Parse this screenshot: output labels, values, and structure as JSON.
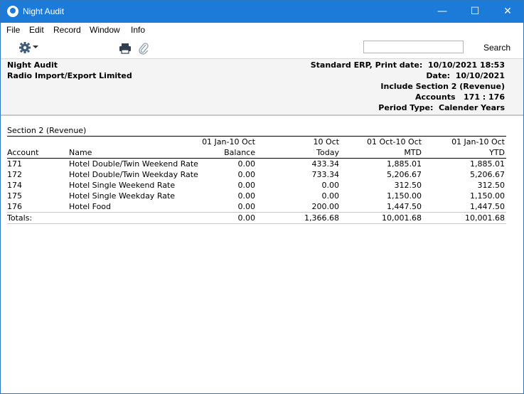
{
  "window": {
    "title": "Night Audit",
    "controls": {
      "minimize": "—",
      "maximize": "☐",
      "close": "✕"
    }
  },
  "menu": [
    "File",
    "Edit",
    "Record",
    "Window",
    "Info"
  ],
  "toolbar": {
    "icons": [
      "gear-icon",
      "chevron-down-icon",
      "printer-icon",
      "paperclip-icon"
    ],
    "search_value": "",
    "search_button": "Search"
  },
  "header": {
    "report_name": "Night Audit",
    "company": "Radio Import/Export Limited",
    "product_line": "Standard ERP, Print date:  10/10/2021 18:53",
    "date_line": "Date:  10/10/2021",
    "include_line": "Include Section 2 (Revenue)",
    "accounts_line": "Accounts   171 : 176",
    "period_line": "Period Type:  Calender Years"
  },
  "report": {
    "section_title": "Section 2 (Revenue)",
    "column_ranges": [
      "01 Jan-10 Oct",
      "10 Oct",
      "01 Oct-10 Oct",
      "01 Jan-10 Oct"
    ],
    "columns": [
      "Account",
      "Name",
      "Balance",
      "Today",
      "MTD",
      "YTD"
    ],
    "rows": [
      [
        "171",
        "Hotel Double/Twin Weekend Rate",
        "0.00",
        "433.34",
        "1,885.01",
        "1,885.01"
      ],
      [
        "172",
        "Hotel Double/Twin Weekday Rate",
        "0.00",
        "733.34",
        "5,206.67",
        "5,206.67"
      ],
      [
        "174",
        "Hotel Single Weekend Rate",
        "0.00",
        "0.00",
        "312.50",
        "312.50"
      ],
      [
        "175",
        "Hotel Single Weekday Rate",
        "0.00",
        "0.00",
        "1,150.00",
        "1,150.00"
      ],
      [
        "176",
        "Hotel Food",
        "0.00",
        "200.00",
        "1,447.50",
        "1,447.50"
      ]
    ],
    "totals": [
      "Totals:",
      "0.00",
      "1,366.68",
      "10,001.68",
      "10,001.68"
    ]
  },
  "colors": {
    "titlebar": "#1c7bd9",
    "header_bg": "#f4f4f4"
  }
}
